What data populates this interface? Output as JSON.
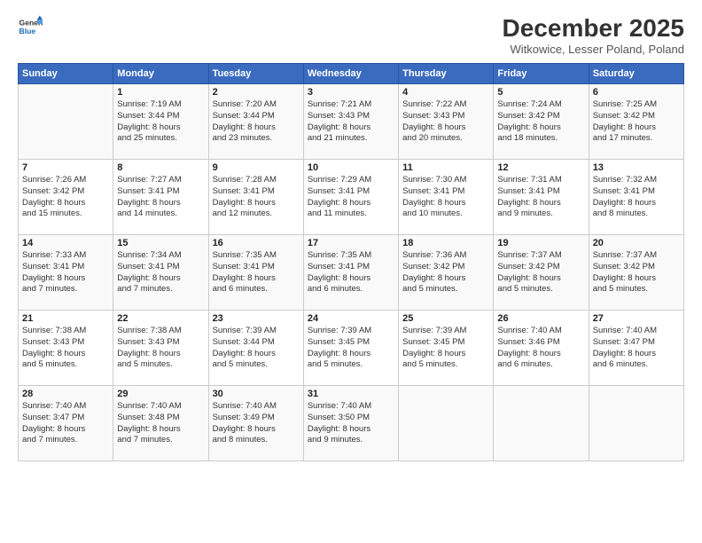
{
  "logo": {
    "line1": "General",
    "line2": "Blue"
  },
  "title": "December 2025",
  "subtitle": "Witkowice, Lesser Poland, Poland",
  "days_header": [
    "Sunday",
    "Monday",
    "Tuesday",
    "Wednesday",
    "Thursday",
    "Friday",
    "Saturday"
  ],
  "weeks": [
    [
      {
        "num": "",
        "info": ""
      },
      {
        "num": "1",
        "info": "Sunrise: 7:19 AM\nSunset: 3:44 PM\nDaylight: 8 hours\nand 25 minutes."
      },
      {
        "num": "2",
        "info": "Sunrise: 7:20 AM\nSunset: 3:44 PM\nDaylight: 8 hours\nand 23 minutes."
      },
      {
        "num": "3",
        "info": "Sunrise: 7:21 AM\nSunset: 3:43 PM\nDaylight: 8 hours\nand 21 minutes."
      },
      {
        "num": "4",
        "info": "Sunrise: 7:22 AM\nSunset: 3:43 PM\nDaylight: 8 hours\nand 20 minutes."
      },
      {
        "num": "5",
        "info": "Sunrise: 7:24 AM\nSunset: 3:42 PM\nDaylight: 8 hours\nand 18 minutes."
      },
      {
        "num": "6",
        "info": "Sunrise: 7:25 AM\nSunset: 3:42 PM\nDaylight: 8 hours\nand 17 minutes."
      }
    ],
    [
      {
        "num": "7",
        "info": "Sunrise: 7:26 AM\nSunset: 3:42 PM\nDaylight: 8 hours\nand 15 minutes."
      },
      {
        "num": "8",
        "info": "Sunrise: 7:27 AM\nSunset: 3:41 PM\nDaylight: 8 hours\nand 14 minutes."
      },
      {
        "num": "9",
        "info": "Sunrise: 7:28 AM\nSunset: 3:41 PM\nDaylight: 8 hours\nand 12 minutes."
      },
      {
        "num": "10",
        "info": "Sunrise: 7:29 AM\nSunset: 3:41 PM\nDaylight: 8 hours\nand 11 minutes."
      },
      {
        "num": "11",
        "info": "Sunrise: 7:30 AM\nSunset: 3:41 PM\nDaylight: 8 hours\nand 10 minutes."
      },
      {
        "num": "12",
        "info": "Sunrise: 7:31 AM\nSunset: 3:41 PM\nDaylight: 8 hours\nand 9 minutes."
      },
      {
        "num": "13",
        "info": "Sunrise: 7:32 AM\nSunset: 3:41 PM\nDaylight: 8 hours\nand 8 minutes."
      }
    ],
    [
      {
        "num": "14",
        "info": "Sunrise: 7:33 AM\nSunset: 3:41 PM\nDaylight: 8 hours\nand 7 minutes."
      },
      {
        "num": "15",
        "info": "Sunrise: 7:34 AM\nSunset: 3:41 PM\nDaylight: 8 hours\nand 7 minutes."
      },
      {
        "num": "16",
        "info": "Sunrise: 7:35 AM\nSunset: 3:41 PM\nDaylight: 8 hours\nand 6 minutes."
      },
      {
        "num": "17",
        "info": "Sunrise: 7:35 AM\nSunset: 3:41 PM\nDaylight: 8 hours\nand 6 minutes."
      },
      {
        "num": "18",
        "info": "Sunrise: 7:36 AM\nSunset: 3:42 PM\nDaylight: 8 hours\nand 5 minutes."
      },
      {
        "num": "19",
        "info": "Sunrise: 7:37 AM\nSunset: 3:42 PM\nDaylight: 8 hours\nand 5 minutes."
      },
      {
        "num": "20",
        "info": "Sunrise: 7:37 AM\nSunset: 3:42 PM\nDaylight: 8 hours\nand 5 minutes."
      }
    ],
    [
      {
        "num": "21",
        "info": "Sunrise: 7:38 AM\nSunset: 3:43 PM\nDaylight: 8 hours\nand 5 minutes."
      },
      {
        "num": "22",
        "info": "Sunrise: 7:38 AM\nSunset: 3:43 PM\nDaylight: 8 hours\nand 5 minutes."
      },
      {
        "num": "23",
        "info": "Sunrise: 7:39 AM\nSunset: 3:44 PM\nDaylight: 8 hours\nand 5 minutes."
      },
      {
        "num": "24",
        "info": "Sunrise: 7:39 AM\nSunset: 3:45 PM\nDaylight: 8 hours\nand 5 minutes."
      },
      {
        "num": "25",
        "info": "Sunrise: 7:39 AM\nSunset: 3:45 PM\nDaylight: 8 hours\nand 5 minutes."
      },
      {
        "num": "26",
        "info": "Sunrise: 7:40 AM\nSunset: 3:46 PM\nDaylight: 8 hours\nand 6 minutes."
      },
      {
        "num": "27",
        "info": "Sunrise: 7:40 AM\nSunset: 3:47 PM\nDaylight: 8 hours\nand 6 minutes."
      }
    ],
    [
      {
        "num": "28",
        "info": "Sunrise: 7:40 AM\nSunset: 3:47 PM\nDaylight: 8 hours\nand 7 minutes."
      },
      {
        "num": "29",
        "info": "Sunrise: 7:40 AM\nSunset: 3:48 PM\nDaylight: 8 hours\nand 7 minutes."
      },
      {
        "num": "30",
        "info": "Sunrise: 7:40 AM\nSunset: 3:49 PM\nDaylight: 8 hours\nand 8 minutes."
      },
      {
        "num": "31",
        "info": "Sunrise: 7:40 AM\nSunset: 3:50 PM\nDaylight: 8 hours\nand 9 minutes."
      },
      {
        "num": "",
        "info": ""
      },
      {
        "num": "",
        "info": ""
      },
      {
        "num": "",
        "info": ""
      }
    ]
  ]
}
